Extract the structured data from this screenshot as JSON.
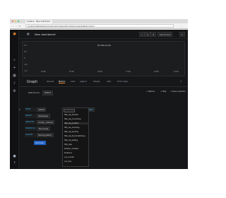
{
  "browser": {
    "tab_title": "Grafana - New dashboard",
    "url": "localhost:3000/dashboard/new?orgId=1&panelId=1&fullscreen&edit&tab=metrics"
  },
  "sidebar": {
    "logo_icon": "grafana-logo",
    "items": [
      "search-icon",
      "plus-icon",
      "dashboards-icon",
      "bell-icon",
      "gear-icon"
    ]
  },
  "topbar": {
    "title": "New dashboard",
    "time_range": "Last 6 hours",
    "refresh": "↻"
  },
  "panel": {
    "no_data": "No data points",
    "y_ticks": [
      "1.0",
      "0.5",
      "0",
      "-0.5",
      "-1.0"
    ],
    "x_ticks": [
      "14:00",
      "15:00",
      "16:00",
      "17:00",
      "18:00",
      "19:00"
    ]
  },
  "editor": {
    "title": "Graph",
    "tabs": [
      "General",
      "Metrics",
      "Axes",
      "Legend",
      "Display",
      "Alert",
      "Time range"
    ],
    "active_tab": "Metrics",
    "datasource_label": "Data Source",
    "datasource_value": "default",
    "options_btn": "+ Options",
    "help_btn": "+ Help",
    "inspector_btn": "+ Query Inspector"
  },
  "query": {
    "rows": [
      {
        "label": "FROM",
        "value": "default"
      },
      {
        "label": "SELECT",
        "value": "field(value)"
      },
      {
        "label": "GROUP BY",
        "value": "time($__interval)"
      },
      {
        "label": "FORMAT AS",
        "value": "Time series"
      },
      {
        "label": "ALIAS BY",
        "value": "Naming pattern"
      }
    ],
    "where": "WHERE",
    "add_query": "Add Query"
  },
  "dropdown": {
    "items": [
      "http_req_blocked",
      "http_req_connecting",
      "http_req_duration",
      "http_req_receiving",
      "http_req_sending",
      "http_req_tls_handshaking",
      "http_req_waiting",
      "http_reqs",
      "iteration_duration",
      "iterations",
      "vus_counter",
      "vus_max"
    ],
    "highlighted_index": 2
  },
  "colors": {
    "background": "#161719",
    "accent": "#f18a29",
    "keyword": "#33b5e5",
    "primary_button": "#1f60c4"
  }
}
